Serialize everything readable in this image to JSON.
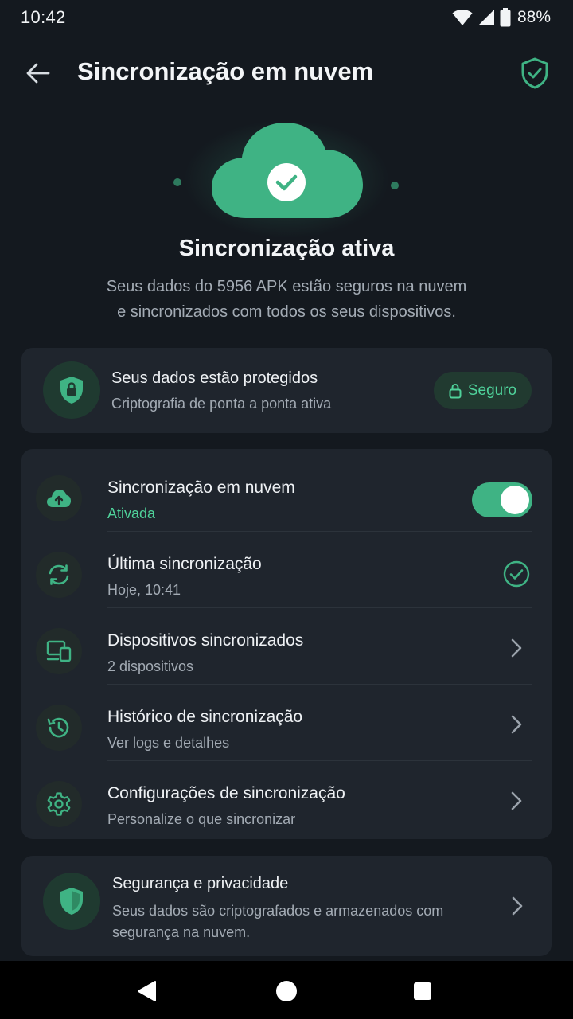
{
  "status_bar": {
    "time": "10:42",
    "battery": "88%"
  },
  "header": {
    "title": "Sincronização em nuvem"
  },
  "hero": {
    "title": "Sincronização ativa",
    "description_line1": "Seus dados do 5956 APK estão seguros na nuvem",
    "description_line2": "e sincronizados com todos os seus dispositivos."
  },
  "protection": {
    "title": "Seus dados estão protegidos",
    "subtitle": "Criptografia de ponta a ponta ativa",
    "badge": "Seguro"
  },
  "sync_items": [
    {
      "label": "Sincronização em nuvem",
      "sub": "Ativada",
      "icon": "cloud-upload-icon",
      "control": "toggle",
      "toggle_on": true
    },
    {
      "label": "Última sincronização",
      "sub": "Hoje, 10:41",
      "icon": "sync-icon",
      "control": "check"
    },
    {
      "label": "Dispositivos sincronizados",
      "sub": "2 dispositivos",
      "icon": "devices-icon",
      "control": "chevron"
    },
    {
      "label": "Histórico de sincronização",
      "sub": "Ver logs e detalhes",
      "icon": "history-icon",
      "control": "chevron"
    },
    {
      "label": "Configurações de sincronização",
      "sub": "Personalize o que sincronizar",
      "icon": "gear-icon",
      "control": "chevron"
    }
  ],
  "security": {
    "title": "Segurança e privacidade",
    "description": "Seus dados são criptografados e armazenados com segurança na nuvem."
  },
  "colors": {
    "accent": "#3fb384",
    "accent_text": "#4fd19a",
    "background": "#14191f",
    "card": "#1f252d"
  }
}
